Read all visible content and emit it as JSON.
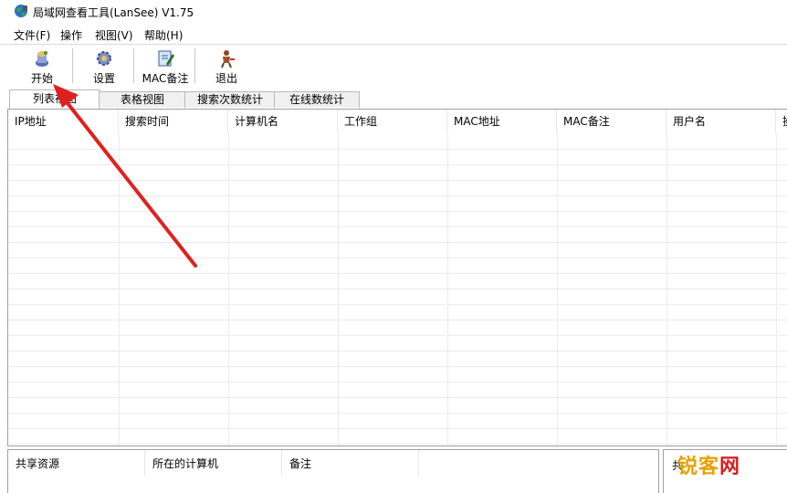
{
  "window": {
    "title": "局域网查看工具(LanSee) V1.75"
  },
  "menu": [
    "文件(F)",
    "操作",
    "视图(V)",
    "帮助(H)"
  ],
  "toolbar": {
    "start": "开始",
    "settings": "设置",
    "mac_note": "MAC备注",
    "exit": "退出"
  },
  "tabs": [
    "列表视图",
    "表格视图",
    "搜索次数统计",
    "在线数统计"
  ],
  "list_columns": [
    "IP地址",
    "搜索时间",
    "计算机名",
    "工作组",
    "MAC地址",
    "MAC备注",
    "用户名",
    "操"
  ],
  "share_columns": [
    "共享资源",
    "所在的计算机",
    "备注"
  ],
  "right_panel": {
    "text": "共"
  },
  "watermark": {
    "part1": "锐客",
    "part2": "网",
    "color1": "#e8a000",
    "color2": "#d62020"
  },
  "annotation": {
    "arrow_color": "#e02020"
  }
}
